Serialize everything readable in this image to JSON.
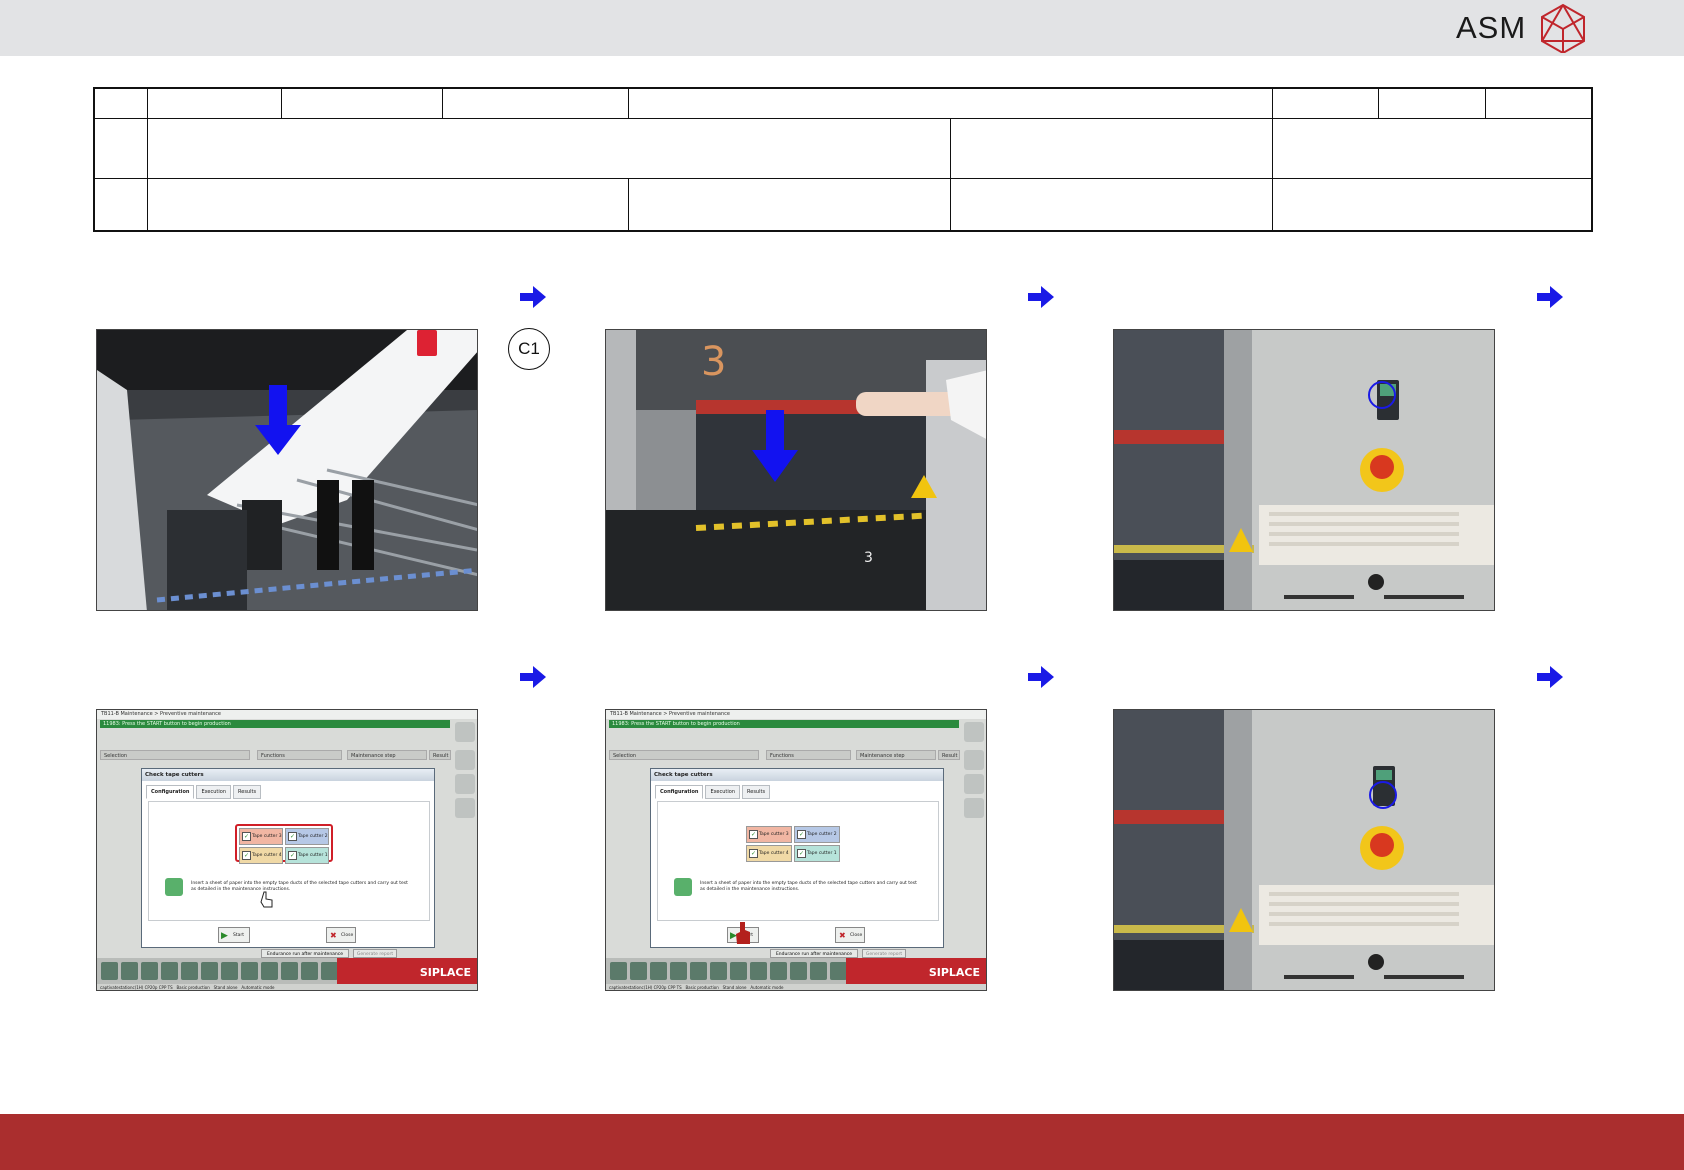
{
  "header": {
    "logo_text": "ASM"
  },
  "steps": [
    {
      "id": "step-1",
      "badge": ""
    },
    {
      "id": "step-2",
      "badge": "C1"
    }
  ],
  "screen": {
    "window_title": "TB11-B Maintenance > Preventive maintenance",
    "message": "11983: Press the START button to begin production",
    "columns": [
      "Selection",
      "Functions",
      "Maintenance step",
      "Result"
    ],
    "dialog": {
      "title": "Check tape cutters",
      "tabs": [
        "Configuration",
        "Execution",
        "Results"
      ],
      "cutters": [
        "Tape cutter 3",
        "Tape cutter 2",
        "Tape cutter 4",
        "Tape cutter 1"
      ],
      "instruction": "Insert a sheet of paper into the empty tape ducts of the selected tape cutters and carry out test as detailed in the maintenance instructions.",
      "start_label": "Start",
      "close_label": "Close"
    },
    "endurance_label": "Endurance run after maintenance",
    "report_label": "Generate report",
    "brand": "SIPLACE",
    "status": [
      "captivatestationc(1H) CP20p CPP TS",
      "Basic production",
      "Stand alone",
      "Automatic mode"
    ]
  },
  "colors": {
    "arrow": "#1a1ae6",
    "footer": "#aa2e2e",
    "topbar": "#e2e3e5",
    "siplace_red": "#c0262c"
  }
}
